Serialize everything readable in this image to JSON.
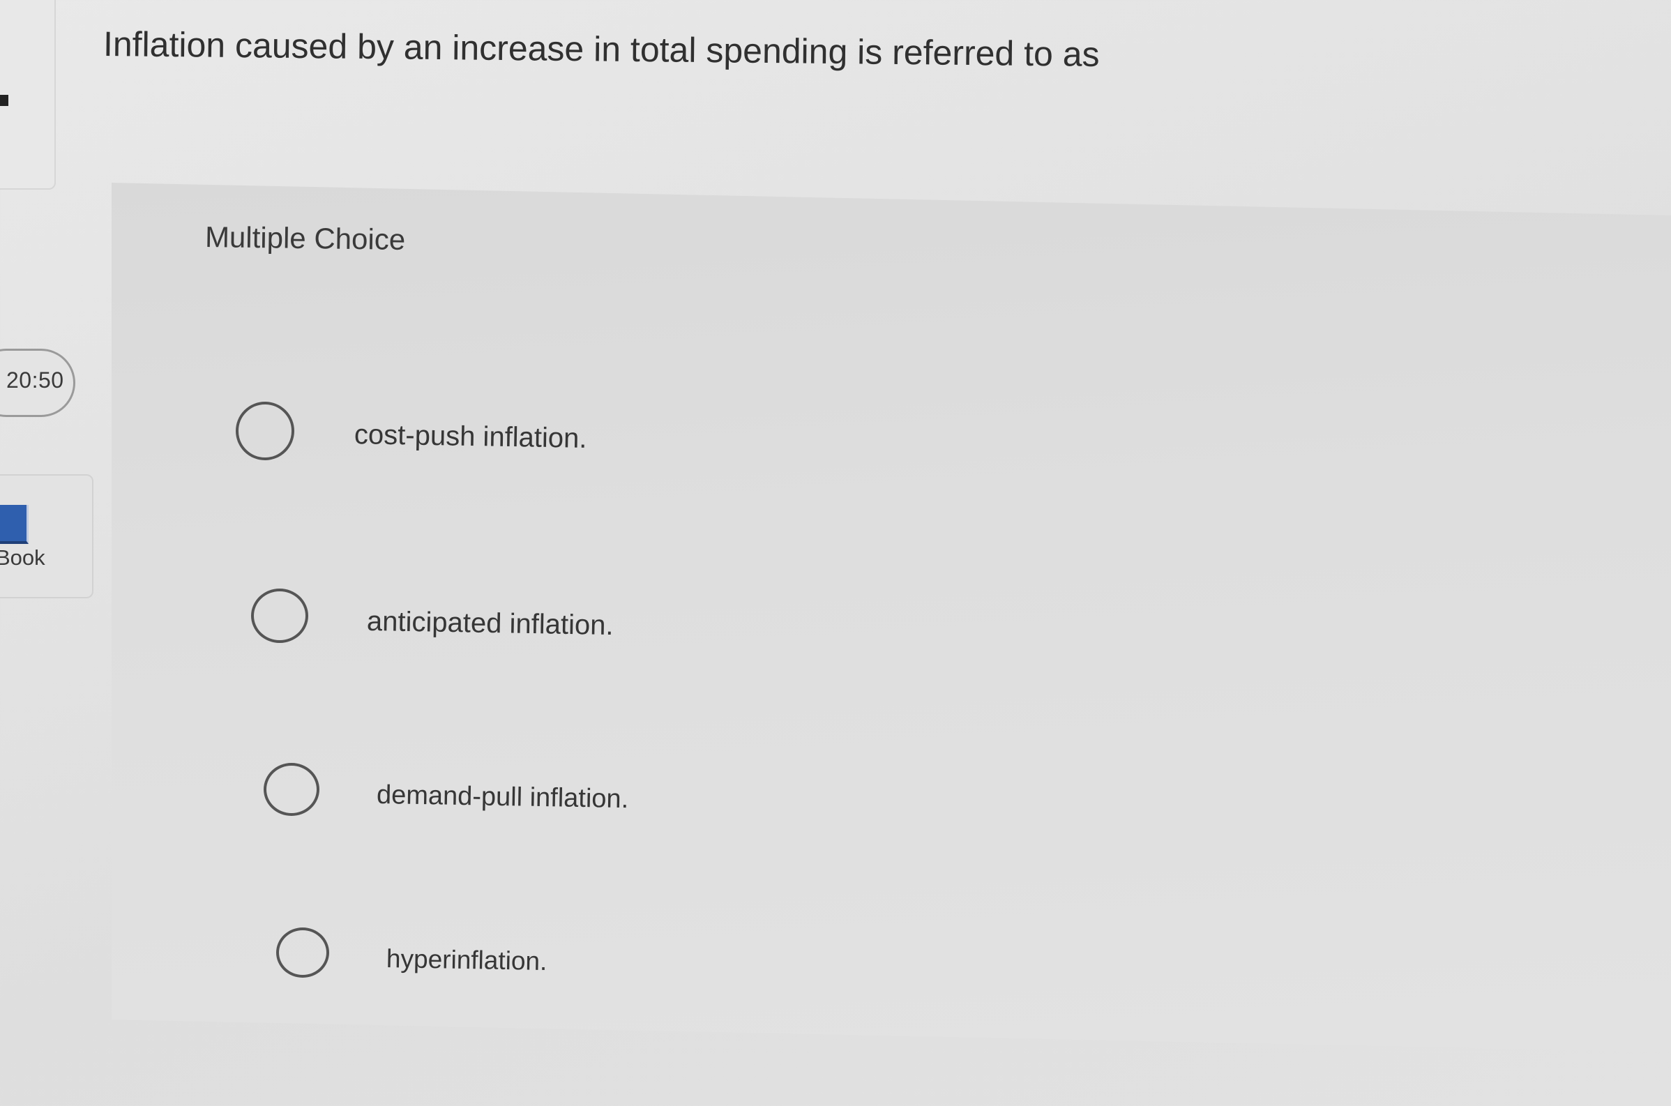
{
  "question": {
    "text": "Inflation caused by an increase in total spending is referred to as"
  },
  "question_type": "Multiple Choice",
  "sidebar": {
    "timer": "20:50",
    "ebook_label": "Book"
  },
  "options": [
    {
      "label": "cost-push inflation.",
      "selected": false
    },
    {
      "label": "anticipated inflation.",
      "selected": false
    },
    {
      "label": "demand-pull inflation.",
      "selected": false
    },
    {
      "label": "hyperinflation.",
      "selected": false
    }
  ]
}
